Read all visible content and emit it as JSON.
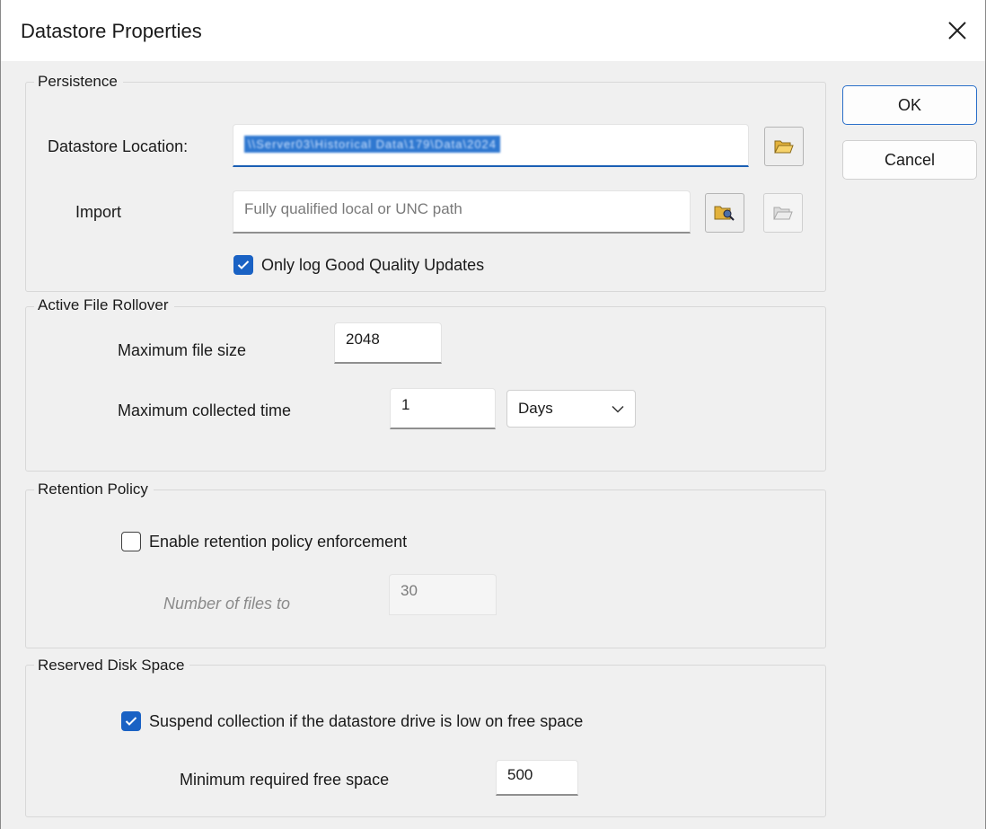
{
  "window": {
    "title": "Datastore Properties",
    "close_glyph": "✕"
  },
  "buttons": {
    "ok_label": "OK",
    "cancel_label": "Cancel"
  },
  "persistence": {
    "group_label": "Persistence",
    "location_label": "Datastore Location:",
    "location_value": "\\\\Server03\\Historical Data\\179\\Data\\2024",
    "import_label": "Import",
    "import_placeholder": "Fully qualified local or UNC path",
    "only_good_quality_label": "Only log Good Quality Updates",
    "only_good_quality_checked": true
  },
  "rollover": {
    "group_label": "Active File Rollover",
    "max_file_size_label": "Maximum file size",
    "max_file_size_value": "2048",
    "max_time_label": "Maximum collected time",
    "max_time_value": "1",
    "time_unit_value": "Days"
  },
  "retention": {
    "group_label": "Retention Policy",
    "enable_label": "Enable retention policy enforcement",
    "enable_checked": false,
    "num_files_label": "Number of files to",
    "num_files_value": "30"
  },
  "disk_space": {
    "group_label": "Reserved Disk Space",
    "suspend_label": "Suspend collection if the datastore drive is low on free space",
    "suspend_checked": true,
    "min_free_label": "Minimum required free space",
    "min_free_value": "500"
  },
  "colors": {
    "accent": "#1a62c4",
    "selection": "#2f78d0"
  }
}
